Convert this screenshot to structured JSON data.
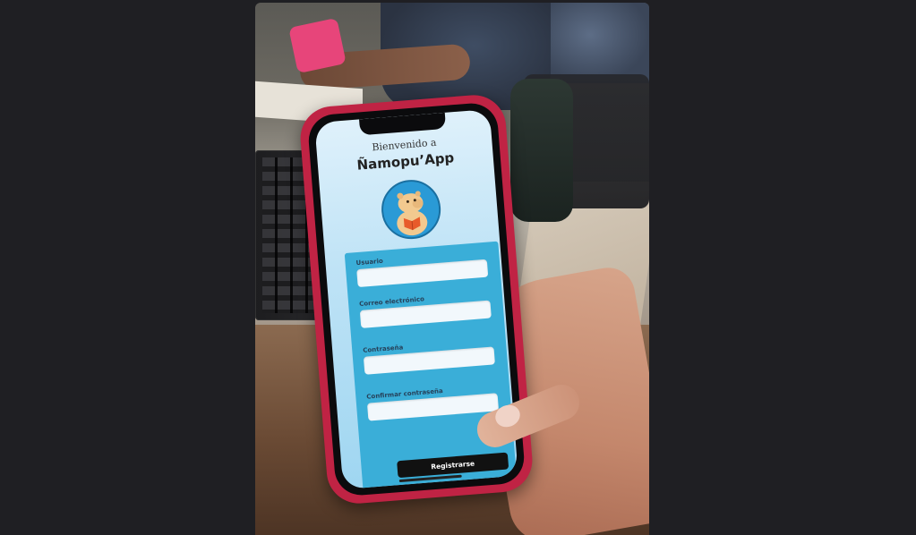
{
  "app": {
    "welcome_text": "Bienvenido a",
    "app_name": "Ñamopu’App"
  },
  "form": {
    "fields": [
      {
        "label": "Usuario"
      },
      {
        "label": "Correo electrónico"
      },
      {
        "label": "Contraseña"
      },
      {
        "label": "Confirmar contraseña"
      }
    ],
    "submit_label": "Registrarse"
  },
  "colors": {
    "phone_case": "#c02344",
    "screen_bg": "#bfe3f6",
    "form_bg": "#3aaed8",
    "button_bg": "#111111"
  },
  "icons": {
    "logo": "capybara-reading-book-icon"
  }
}
